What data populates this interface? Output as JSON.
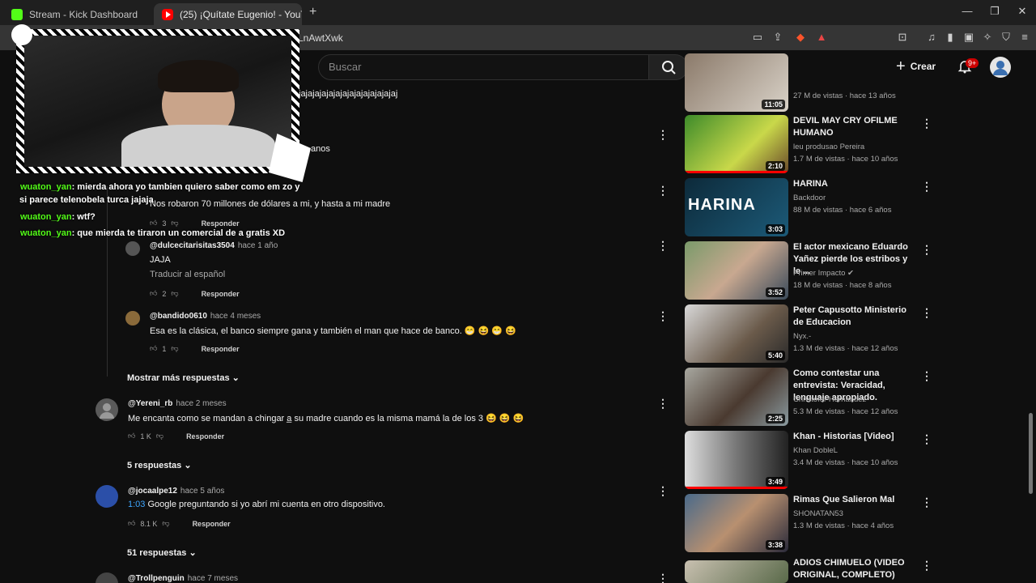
{
  "browser": {
    "tabs": [
      {
        "title": "Stream - Kick Dashboard"
      },
      {
        "title": "(25) ¡Quítate Eugenio! - YouTube"
      }
    ],
    "url_partial": "LnAwtXwk"
  },
  "header": {
    "search_placeholder": "Buscar",
    "create_label": "Crear",
    "notif_badge": "9+"
  },
  "overlay": {
    "chat": [
      {
        "user": "wuaton_yan",
        "msg": ": mierda ahora yo tambien quiero saber como em  zo y"
      },
      {
        "user": "",
        "msg": "si parece telenobela turca jajaja"
      },
      {
        "user": "wuaton_yan",
        "msg": ": wtf?"
      },
      {
        "user": "wuaton_yan",
        "msg": ": que mierda te tiraron un comercial de a gratis XD"
      }
    ],
    "partial_text_1": "jajajajajajajajajajajajajajaj",
    "partial_text_2": "anos"
  },
  "comments": {
    "reply_label": "Responder",
    "translate_label": "Traducir al español",
    "items": [
      {
        "text": "Nos robaron 70 millones de dólares a mi, y hasta a mi madre",
        "likes": "3"
      },
      {
        "user": "@dulcecitarisitas3504",
        "time": "hace 1 año",
        "text": "JAJA",
        "likes": "2"
      },
      {
        "user": "@bandido0610",
        "time": "hace 4 meses",
        "text": "Esa es la clásica, el banco siempre gana y también el man que hace de banco. 😁 😆 😁 😆",
        "likes": "1"
      },
      {
        "user": "@Yereni_rb",
        "time": "hace 2 meses",
        "text": "Me encanta como se mandan a chingar a̲ su madre cuando es la misma mamá la de los 3 😆 😆 😆",
        "likes": "1 K",
        "replies": "5 respuestas"
      },
      {
        "user": "@jocaalpe12",
        "time": "hace 5 años",
        "timestamp": "1:03",
        "text": " Google preguntando si yo abrí mi cuenta en otro dispositivo.",
        "likes": "8.1 K",
        "replies": "51 respuestas"
      },
      {
        "user": "@Trollpenguin",
        "time": "hace 7 meses"
      }
    ],
    "show_more": "Mostrar más respuestas"
  },
  "sidebar": {
    "videos": [
      {
        "title": "",
        "channel": "",
        "meta": "27 M de vistas · hace 13 años",
        "duration": "11:05"
      },
      {
        "title": "DEVIL MAY CRY OFILME HUMANO",
        "channel": "leu produsao Pereira",
        "meta": "1.7 M de vistas · hace 10 años",
        "duration": "2:10"
      },
      {
        "title": "HARINA",
        "channel": "Backdoor",
        "meta": "88 M de vistas · hace 6 años",
        "duration": "3:03",
        "thumb_text": "HARINA"
      },
      {
        "title": "El actor mexicano Eduardo Yañez pierde los estribos y le ...",
        "channel": "Primer Impacto",
        "meta": "18 M de vistas · hace 8 años",
        "duration": "3:52"
      },
      {
        "title": "Peter Capusotto  Ministerio de Educacion",
        "channel": "Nyx.-",
        "meta": "1.3 M de vistas · hace 12 años",
        "duration": "5:40"
      },
      {
        "title": "Como contestar una entrevista: Veracidad, lenguaje apropiado.",
        "channel": "Christofer Hernandez",
        "meta": "5.3 M de vistas · hace 12 años",
        "duration": "2:25"
      },
      {
        "title": "Khan - Historias [Video]",
        "channel": "Khan DobleL",
        "meta": "3.4 M de vistas · hace 10 años",
        "duration": "3:49"
      },
      {
        "title": "Rimas Que Salieron Mal",
        "channel": "SHONATAN53",
        "meta": "1.3 M de vistas · hace 4 años",
        "duration": "3:38"
      },
      {
        "title": "ADIOS CHIMUELO (VIDEO ORIGINAL, COMPLETO)",
        "channel": "",
        "meta": "",
        "duration": ""
      }
    ]
  },
  "colors": {
    "accent_red": "#ff0000",
    "kick_green": "#53fc18",
    "link_blue": "#3ea6ff",
    "bg": "#0f0f0f"
  }
}
